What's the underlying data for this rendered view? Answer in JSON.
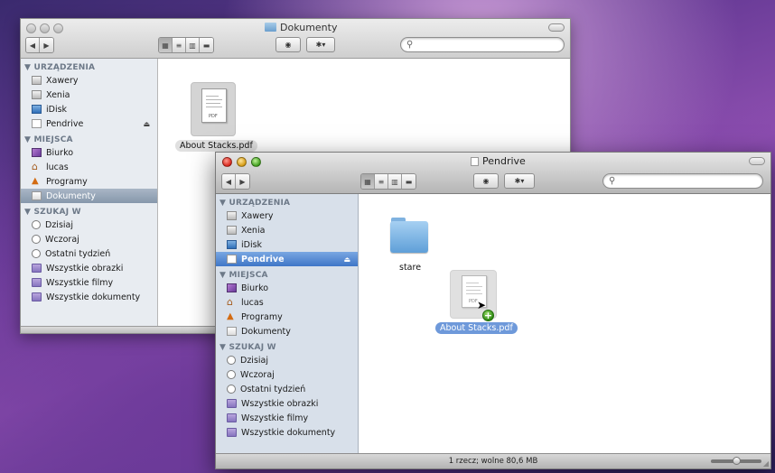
{
  "window_back": {
    "title": "Dokumenty",
    "search": {
      "value": ""
    },
    "sidebar": {
      "sections": [
        {
          "heading": "▼ URZĄDZENIA",
          "items": [
            {
              "label": "Xawery",
              "icon": "hard-disk-icon"
            },
            {
              "label": "Xenia",
              "icon": "hard-disk-icon"
            },
            {
              "label": "iDisk",
              "icon": "idisk-icon"
            },
            {
              "label": "Pendrive",
              "icon": "removable-drive-icon"
            }
          ]
        },
        {
          "heading": "▼ MIEJSCA",
          "items": [
            {
              "label": "Biurko",
              "icon": "desktop-icon"
            },
            {
              "label": "lucas",
              "icon": "home-icon"
            },
            {
              "label": "Programy",
              "icon": "applications-icon"
            },
            {
              "label": "Dokumenty",
              "icon": "documents-icon",
              "selected": true
            }
          ]
        },
        {
          "heading": "▼ SZUKAJ W",
          "items": [
            {
              "label": "Dzisiaj",
              "icon": "clock-icon"
            },
            {
              "label": "Wczoraj",
              "icon": "clock-icon"
            },
            {
              "label": "Ostatni tydzień",
              "icon": "clock-icon"
            },
            {
              "label": "Wszystkie obrazki",
              "icon": "smart-folder-icon"
            },
            {
              "label": "Wszystkie filmy",
              "icon": "smart-folder-icon"
            },
            {
              "label": "Wszystkie dokumenty",
              "icon": "smart-folder-icon"
            }
          ]
        }
      ]
    },
    "files": [
      {
        "name": "About Stacks.pdf",
        "icon": "pdf-file-icon"
      }
    ]
  },
  "window_front": {
    "title": "Pendrive",
    "search": {
      "value": ""
    },
    "sidebar": {
      "sections": [
        {
          "heading": "▼ URZĄDZENIA",
          "items": [
            {
              "label": "Xawery",
              "icon": "hard-disk-icon"
            },
            {
              "label": "Xenia",
              "icon": "hard-disk-icon"
            },
            {
              "label": "iDisk",
              "icon": "idisk-icon"
            },
            {
              "label": "Pendrive",
              "icon": "removable-drive-icon",
              "selected": true
            }
          ]
        },
        {
          "heading": "▼ MIEJSCA",
          "items": [
            {
              "label": "Biurko",
              "icon": "desktop-icon"
            },
            {
              "label": "lucas",
              "icon": "home-icon"
            },
            {
              "label": "Programy",
              "icon": "applications-icon"
            },
            {
              "label": "Dokumenty",
              "icon": "documents-icon"
            }
          ]
        },
        {
          "heading": "▼ SZUKAJ W",
          "items": [
            {
              "label": "Dzisiaj",
              "icon": "clock-icon"
            },
            {
              "label": "Wczoraj",
              "icon": "clock-icon"
            },
            {
              "label": "Ostatni tydzień",
              "icon": "clock-icon"
            },
            {
              "label": "Wszystkie obrazki",
              "icon": "smart-folder-icon"
            },
            {
              "label": "Wszystkie filmy",
              "icon": "smart-folder-icon"
            },
            {
              "label": "Wszystkie dokumenty",
              "icon": "smart-folder-icon"
            }
          ]
        }
      ]
    },
    "files": [
      {
        "name": "stare",
        "icon": "folder-icon"
      },
      {
        "name": "About Stacks.pdf",
        "icon": "pdf-file-icon",
        "dragging": true
      }
    ],
    "status": "1 rzecz; wolne 80,6 MB"
  },
  "glyphs": {
    "back": "◀",
    "forward": "▶",
    "eye": "◉",
    "gear": "✱▾",
    "search": "⚲",
    "eject": "⏏",
    "pdf": "PDF",
    "plus": "+"
  }
}
